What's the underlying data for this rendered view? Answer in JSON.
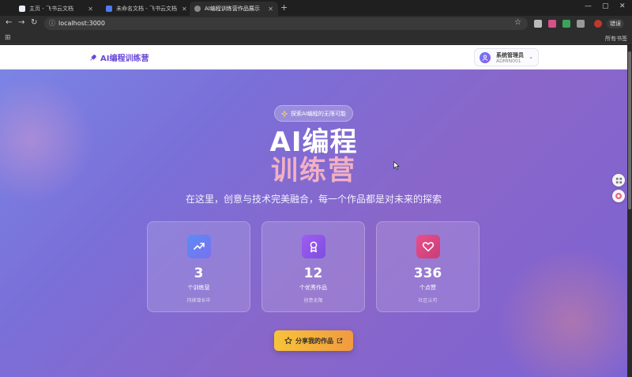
{
  "browser": {
    "tabs": [
      {
        "title": "主页 - 飞书云文档",
        "active": false
      },
      {
        "title": "未命名文档 - 飞书云文档",
        "active": false
      },
      {
        "title": "AI编程训练营作品展示",
        "active": true
      }
    ],
    "url": "localhost:3000",
    "update_label": "错误",
    "bookmarks_label": "所有书签"
  },
  "header": {
    "brand": "AI编程训练营",
    "user_name": "系统管理员",
    "user_id": "ADMIN001"
  },
  "hero": {
    "badge": "探索AI编程的无限可能",
    "title_line1": "AI编程",
    "title_line2": "训练营",
    "subtitle": "在这里，创意与技术完美融合，每一个作品都是对未来的探索"
  },
  "stats": [
    {
      "value": "3",
      "label": "个训练营",
      "sub": "持续增长中",
      "icon": "trending-up-icon",
      "color": "#5b8cf5"
    },
    {
      "value": "12",
      "label": "个优秀作品",
      "sub": "创意无限",
      "icon": "award-icon",
      "color": "#9b5cf0"
    },
    {
      "value": "336",
      "label": "个点赞",
      "sub": "社区认可",
      "icon": "heart-icon",
      "color": "#e0477f"
    }
  ],
  "cta": {
    "label": "分享我的作品"
  },
  "colors": {
    "brand": "#6a48d8",
    "accent_gold": "#f7c33a",
    "title_pink": "#f2b0c3"
  }
}
